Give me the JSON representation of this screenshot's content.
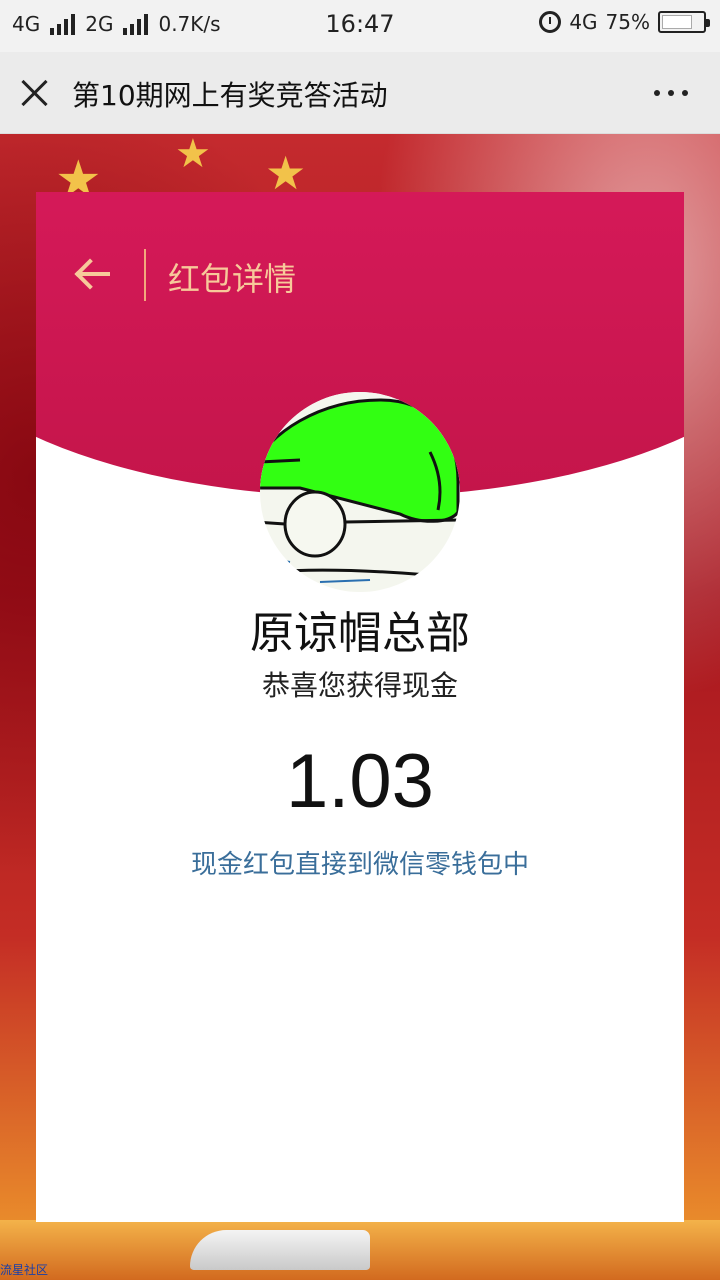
{
  "status_bar": {
    "network1": "4G",
    "network2": "2G",
    "speed": "0.7K/s",
    "time": "16:47",
    "network3": "4G",
    "battery": "75%"
  },
  "titlebar": {
    "title": "第10期网上有奖竞答活动"
  },
  "card": {
    "header_title": "红包详情",
    "sender_name": "原谅帽总部",
    "greeting": "恭喜您获得现金",
    "amount": "1.03",
    "note": "现金红包直接到微信零钱包中"
  },
  "footer": {
    "watermark": "流星社区"
  },
  "colors": {
    "header_top": "#ff1f6a",
    "header_bottom": "#c4154a",
    "header_text": "#f7c99a",
    "note_text": "#3a6e9a"
  },
  "icons": [
    "close-icon",
    "more-icon",
    "back-arrow-icon",
    "alarm-icon",
    "battery-icon",
    "signal-icon"
  ]
}
